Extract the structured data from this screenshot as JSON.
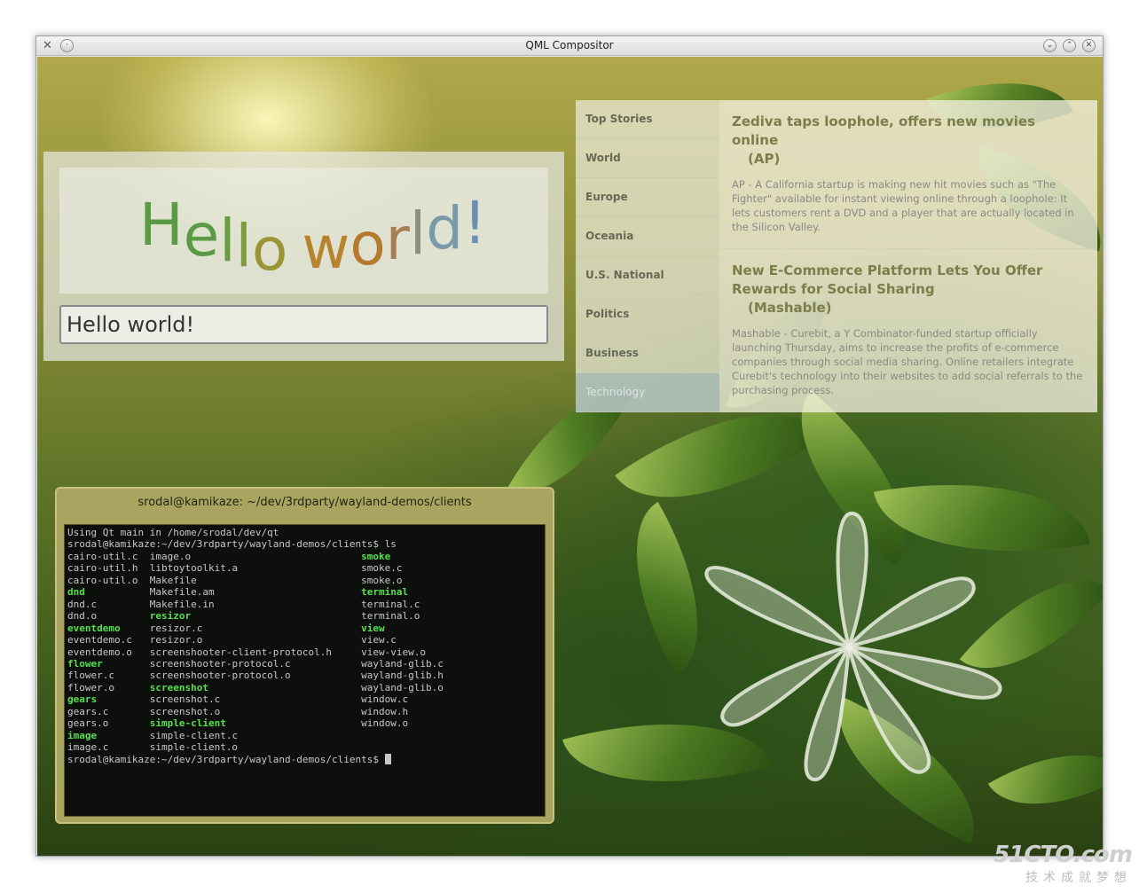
{
  "window": {
    "title": "QML Compositor"
  },
  "hello": {
    "big_letters": [
      "H",
      "e",
      "l",
      "l",
      "o",
      " ",
      "w",
      "o",
      "r",
      "l",
      "d",
      "!"
    ],
    "input_value": "Hello world!"
  },
  "news": {
    "tabs": [
      {
        "label": "Top Stories"
      },
      {
        "label": "World"
      },
      {
        "label": "Europe"
      },
      {
        "label": "Oceania"
      },
      {
        "label": "U.S. National"
      },
      {
        "label": "Politics"
      },
      {
        "label": "Business"
      },
      {
        "label": "Technology"
      }
    ],
    "articles": [
      {
        "title": "Zediva taps loophole, offers new movies online",
        "source": "(AP)",
        "summary": "AP - A California startup is making new hit movies such as \"The Fighter\" available for instant viewing online through a loophole: It lets customers rent a DVD and a player that are actually located in the Silicon Valley."
      },
      {
        "title": "New E-Commerce Platform Lets You Offer Rewards for Social Sharing",
        "source": "(Mashable)",
        "summary": "Mashable - Curebit, a Y Combinator-funded startup officially launching Thursday, aims to increase the profits of e-commerce companies through social media sharing. Online retailers integrate Curebit's technology into their websites to add social referrals to the purchasing process."
      }
    ]
  },
  "terminal": {
    "title": "srodal@kamikaze: ~/dev/3rdparty/wayland-demos/clients",
    "line1": "Using Qt main in /home/srodal/dev/qt",
    "prompt_ls": "srodal@kamikaze:~/dev/3rdparty/wayland-demos/clients$ ls",
    "files": [
      [
        "cairo-util.c",
        "n"
      ],
      [
        "image.o",
        "n"
      ],
      [
        "smoke",
        "g"
      ],
      [
        "cairo-util.h",
        "n"
      ],
      [
        "libtoytoolkit.a",
        "n"
      ],
      [
        "smoke.c",
        "n"
      ],
      [
        "cairo-util.o",
        "n"
      ],
      [
        "Makefile",
        "n"
      ],
      [
        "smoke.o",
        "n"
      ],
      [
        "dnd",
        "g"
      ],
      [
        "Makefile.am",
        "n"
      ],
      [
        "terminal",
        "g"
      ],
      [
        "dnd.c",
        "n"
      ],
      [
        "Makefile.in",
        "n"
      ],
      [
        "terminal.c",
        "n"
      ],
      [
        "dnd.o",
        "n"
      ],
      [
        "resizor",
        "g"
      ],
      [
        "terminal.o",
        "n"
      ],
      [
        "eventdemo",
        "g"
      ],
      [
        "resizor.c",
        "n"
      ],
      [
        "view",
        "g"
      ],
      [
        "eventdemo.c",
        "n"
      ],
      [
        "resizor.o",
        "n"
      ],
      [
        "view.c",
        "n"
      ],
      [
        "eventdemo.o",
        "n"
      ],
      [
        "screenshooter-client-protocol.h",
        "n"
      ],
      [
        "view-view.o",
        "n"
      ],
      [
        "flower",
        "g"
      ],
      [
        "screenshooter-protocol.c",
        "n"
      ],
      [
        "wayland-glib.c",
        "n"
      ],
      [
        "flower.c",
        "n"
      ],
      [
        "screenshooter-protocol.o",
        "n"
      ],
      [
        "wayland-glib.h",
        "n"
      ],
      [
        "flower.o",
        "n"
      ],
      [
        "screenshot",
        "g"
      ],
      [
        "wayland-glib.o",
        "n"
      ],
      [
        "gears",
        "g"
      ],
      [
        "screenshot.c",
        "n"
      ],
      [
        "window.c",
        "n"
      ],
      [
        "gears.c",
        "n"
      ],
      [
        "screenshot.o",
        "n"
      ],
      [
        "window.h",
        "n"
      ],
      [
        "gears.o",
        "n"
      ],
      [
        "simple-client",
        "g"
      ],
      [
        "window.o",
        "n"
      ],
      [
        "image",
        "g"
      ],
      [
        "simple-client.c",
        "n"
      ],
      [
        "",
        "n"
      ],
      [
        "image.c",
        "n"
      ],
      [
        "simple-client.o",
        "n"
      ],
      [
        "",
        "n"
      ]
    ],
    "prompt_final": "srodal@kamikaze:~/dev/3rdparty/wayland-demos/clients$ "
  },
  "watermark": {
    "brand": "51CTO.com",
    "sub": "技术成就梦想"
  },
  "colors": {
    "hello_green": "#5a9a45",
    "hello_orange": "#b7832f",
    "hello_blue": "#7a9aa8",
    "terminal_green": "#56e04d",
    "news_title": "#7b7e4a"
  }
}
